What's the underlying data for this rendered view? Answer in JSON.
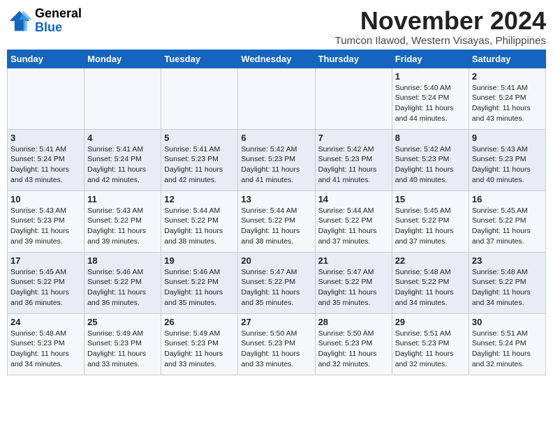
{
  "header": {
    "logo_general": "General",
    "logo_blue": "Blue",
    "month_title": "November 2024",
    "subtitle": "Tumcon Ilawod, Western Visayas, Philippines"
  },
  "days_of_week": [
    "Sunday",
    "Monday",
    "Tuesday",
    "Wednesday",
    "Thursday",
    "Friday",
    "Saturday"
  ],
  "weeks": [
    [
      {
        "day": "",
        "info": ""
      },
      {
        "day": "",
        "info": ""
      },
      {
        "day": "",
        "info": ""
      },
      {
        "day": "",
        "info": ""
      },
      {
        "day": "",
        "info": ""
      },
      {
        "day": "1",
        "info": "Sunrise: 5:40 AM\nSunset: 5:24 PM\nDaylight: 11 hours and 44 minutes."
      },
      {
        "day": "2",
        "info": "Sunrise: 5:41 AM\nSunset: 5:24 PM\nDaylight: 11 hours and 43 minutes."
      }
    ],
    [
      {
        "day": "3",
        "info": "Sunrise: 5:41 AM\nSunset: 5:24 PM\nDaylight: 11 hours and 43 minutes."
      },
      {
        "day": "4",
        "info": "Sunrise: 5:41 AM\nSunset: 5:24 PM\nDaylight: 11 hours and 42 minutes."
      },
      {
        "day": "5",
        "info": "Sunrise: 5:41 AM\nSunset: 5:23 PM\nDaylight: 11 hours and 42 minutes."
      },
      {
        "day": "6",
        "info": "Sunrise: 5:42 AM\nSunset: 5:23 PM\nDaylight: 11 hours and 41 minutes."
      },
      {
        "day": "7",
        "info": "Sunrise: 5:42 AM\nSunset: 5:23 PM\nDaylight: 11 hours and 41 minutes."
      },
      {
        "day": "8",
        "info": "Sunrise: 5:42 AM\nSunset: 5:23 PM\nDaylight: 11 hours and 40 minutes."
      },
      {
        "day": "9",
        "info": "Sunrise: 5:43 AM\nSunset: 5:23 PM\nDaylight: 11 hours and 40 minutes."
      }
    ],
    [
      {
        "day": "10",
        "info": "Sunrise: 5:43 AM\nSunset: 5:23 PM\nDaylight: 11 hours and 39 minutes."
      },
      {
        "day": "11",
        "info": "Sunrise: 5:43 AM\nSunset: 5:22 PM\nDaylight: 11 hours and 39 minutes."
      },
      {
        "day": "12",
        "info": "Sunrise: 5:44 AM\nSunset: 5:22 PM\nDaylight: 11 hours and 38 minutes."
      },
      {
        "day": "13",
        "info": "Sunrise: 5:44 AM\nSunset: 5:22 PM\nDaylight: 11 hours and 38 minutes."
      },
      {
        "day": "14",
        "info": "Sunrise: 5:44 AM\nSunset: 5:22 PM\nDaylight: 11 hours and 37 minutes."
      },
      {
        "day": "15",
        "info": "Sunrise: 5:45 AM\nSunset: 5:22 PM\nDaylight: 11 hours and 37 minutes."
      },
      {
        "day": "16",
        "info": "Sunrise: 5:45 AM\nSunset: 5:22 PM\nDaylight: 11 hours and 37 minutes."
      }
    ],
    [
      {
        "day": "17",
        "info": "Sunrise: 5:45 AM\nSunset: 5:22 PM\nDaylight: 11 hours and 36 minutes."
      },
      {
        "day": "18",
        "info": "Sunrise: 5:46 AM\nSunset: 5:22 PM\nDaylight: 11 hours and 36 minutes."
      },
      {
        "day": "19",
        "info": "Sunrise: 5:46 AM\nSunset: 5:22 PM\nDaylight: 11 hours and 35 minutes."
      },
      {
        "day": "20",
        "info": "Sunrise: 5:47 AM\nSunset: 5:22 PM\nDaylight: 11 hours and 35 minutes."
      },
      {
        "day": "21",
        "info": "Sunrise: 5:47 AM\nSunset: 5:22 PM\nDaylight: 11 hours and 35 minutes."
      },
      {
        "day": "22",
        "info": "Sunrise: 5:48 AM\nSunset: 5:22 PM\nDaylight: 11 hours and 34 minutes."
      },
      {
        "day": "23",
        "info": "Sunrise: 5:48 AM\nSunset: 5:22 PM\nDaylight: 11 hours and 34 minutes."
      }
    ],
    [
      {
        "day": "24",
        "info": "Sunrise: 5:48 AM\nSunset: 5:23 PM\nDaylight: 11 hours and 34 minutes."
      },
      {
        "day": "25",
        "info": "Sunrise: 5:49 AM\nSunset: 5:23 PM\nDaylight: 11 hours and 33 minutes."
      },
      {
        "day": "26",
        "info": "Sunrise: 5:49 AM\nSunset: 5:23 PM\nDaylight: 11 hours and 33 minutes."
      },
      {
        "day": "27",
        "info": "Sunrise: 5:50 AM\nSunset: 5:23 PM\nDaylight: 11 hours and 33 minutes."
      },
      {
        "day": "28",
        "info": "Sunrise: 5:50 AM\nSunset: 5:23 PM\nDaylight: 11 hours and 32 minutes."
      },
      {
        "day": "29",
        "info": "Sunrise: 5:51 AM\nSunset: 5:23 PM\nDaylight: 11 hours and 32 minutes."
      },
      {
        "day": "30",
        "info": "Sunrise: 5:51 AM\nSunset: 5:24 PM\nDaylight: 11 hours and 32 minutes."
      }
    ]
  ]
}
